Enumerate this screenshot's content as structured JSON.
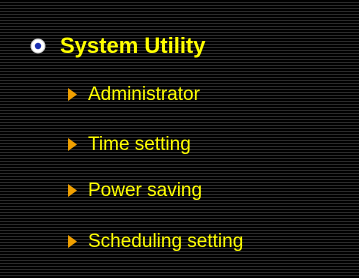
{
  "menu": {
    "section": {
      "title": "System Utility",
      "icon": "radio-selected-icon"
    },
    "items": [
      {
        "label": "Administrator",
        "icon": "arrow-right-icon"
      },
      {
        "label": "Time setting",
        "icon": "arrow-right-icon"
      },
      {
        "label": "Power saving",
        "icon": "arrow-right-icon"
      },
      {
        "label": "Scheduling setting",
        "icon": "arrow-right-icon"
      }
    ]
  },
  "colors": {
    "text": "#ffff00",
    "arrow": "#f0a000",
    "background": "#000000",
    "stripe": "#2b2b2b"
  }
}
